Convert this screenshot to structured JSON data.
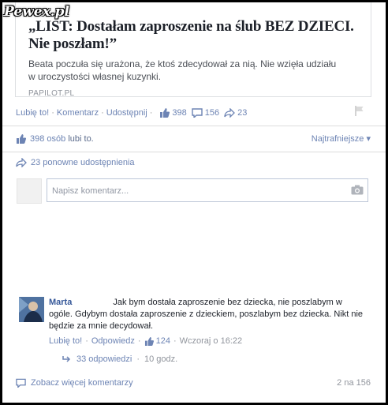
{
  "watermark": "Pewex.pl",
  "link_card": {
    "title": "„LIST: Dostałam zaproszenie na ślub BEZ DZIECI. Nie poszłam!”",
    "description": "Beata poczuła się urażona, że ktoś zdecydował za nią. Nie wzięła udziału w uroczystości własnej kuzynki.",
    "source": "PAPILOT.PL"
  },
  "post_actions": {
    "like": "Lubię to!",
    "comment": "Komentarz",
    "share": "Udostępnij",
    "likes_count": "398",
    "comments_count": "156",
    "shares_count": "23",
    "sep": "·"
  },
  "likes_summary": {
    "count": "398 osób",
    "suffix": "lubi to.",
    "sort_label": "Najtrafniejsze ▾"
  },
  "shares_summary": "23 ponowne udostępnienia",
  "comment_input": {
    "placeholder": "Napisz komentarz..."
  },
  "comment": {
    "author": "Marta",
    "text": "Jak bym dostała zaproszenie bez dziecka, nie poszlabym w ogóle. Gdybym dostała zaproszenie z dzieckiem, poszlabym bez dziecka. Nikt nie będzie za mnie decydował.",
    "like": "Lubię to!",
    "reply": "Odpowiedz",
    "likes": "124",
    "time": "Wczoraj o 16:22",
    "sep": "·"
  },
  "replies": {
    "count": "33 odpowiedzi",
    "time": "10 godz.",
    "sep": "·"
  },
  "footer": {
    "more": "Zobacz więcej komentarzy",
    "pager": "2 na 156"
  },
  "colors": {
    "link": "#6d84b4",
    "name": "#365899",
    "muted": "#90949c"
  }
}
